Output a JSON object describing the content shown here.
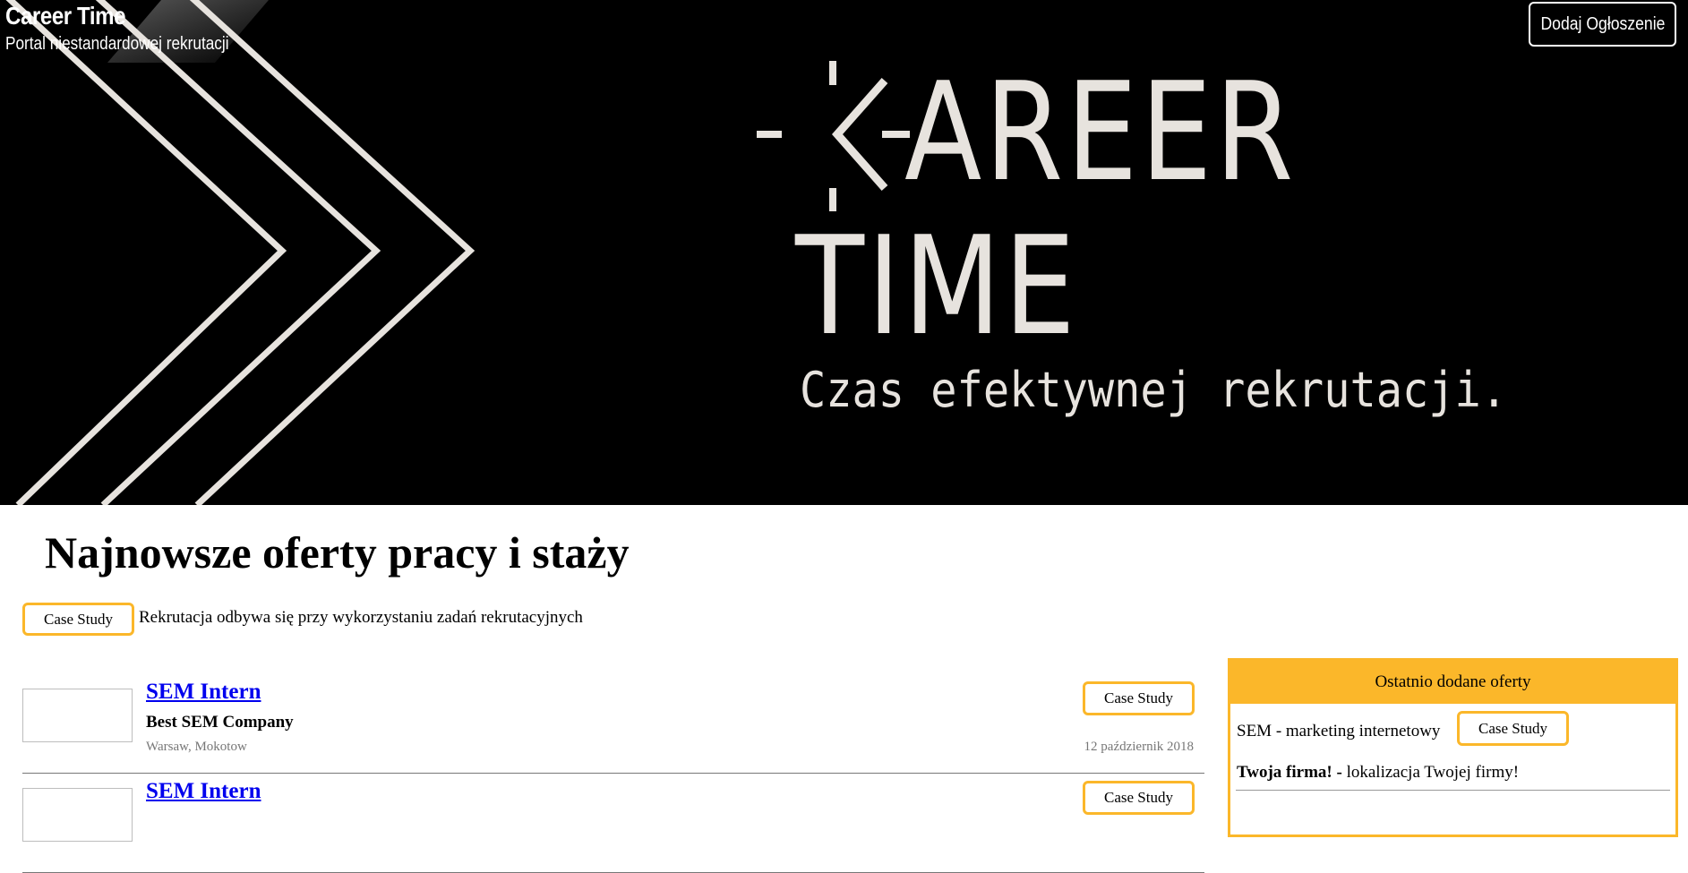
{
  "header": {
    "site_title": "Career Time",
    "site_subtitle": "Portal niestandardowej rekrutacji",
    "add_button_label": "Dodaj Ogłoszenie"
  },
  "hero": {
    "logo_line1": "AREER",
    "logo_line2": "TIME",
    "tagline": "Czas efektywnej rekrutacji."
  },
  "main": {
    "heading": "Najnowsze oferty pracy i staży",
    "legend": {
      "badge_label": "Case Study",
      "text": "Rekrutacja odbywa się przy wykorzystaniu zadań rekrutacyjnych"
    },
    "offers": [
      {
        "title": "SEM Intern",
        "company": "Best SEM Company",
        "location": "Warsaw, Mokotow",
        "badge": "Case Study",
        "date": "12 październik 2018"
      },
      {
        "title": "SEM Intern",
        "company": "",
        "location": "",
        "badge": "Case Study",
        "date": ""
      }
    ]
  },
  "sidebar": {
    "title": "Ostatnio dodane oferty",
    "item_text": "SEM - marketing internetowy",
    "item_badge": "Case Study",
    "company_name": "Twoja firma! -",
    "company_location": " lokalizacja Twojej firmy!"
  },
  "colors": {
    "accent": "#fbb72a",
    "hero_bg": "#000000",
    "link": "#0000ee",
    "logo_text": "#e7e3de"
  }
}
